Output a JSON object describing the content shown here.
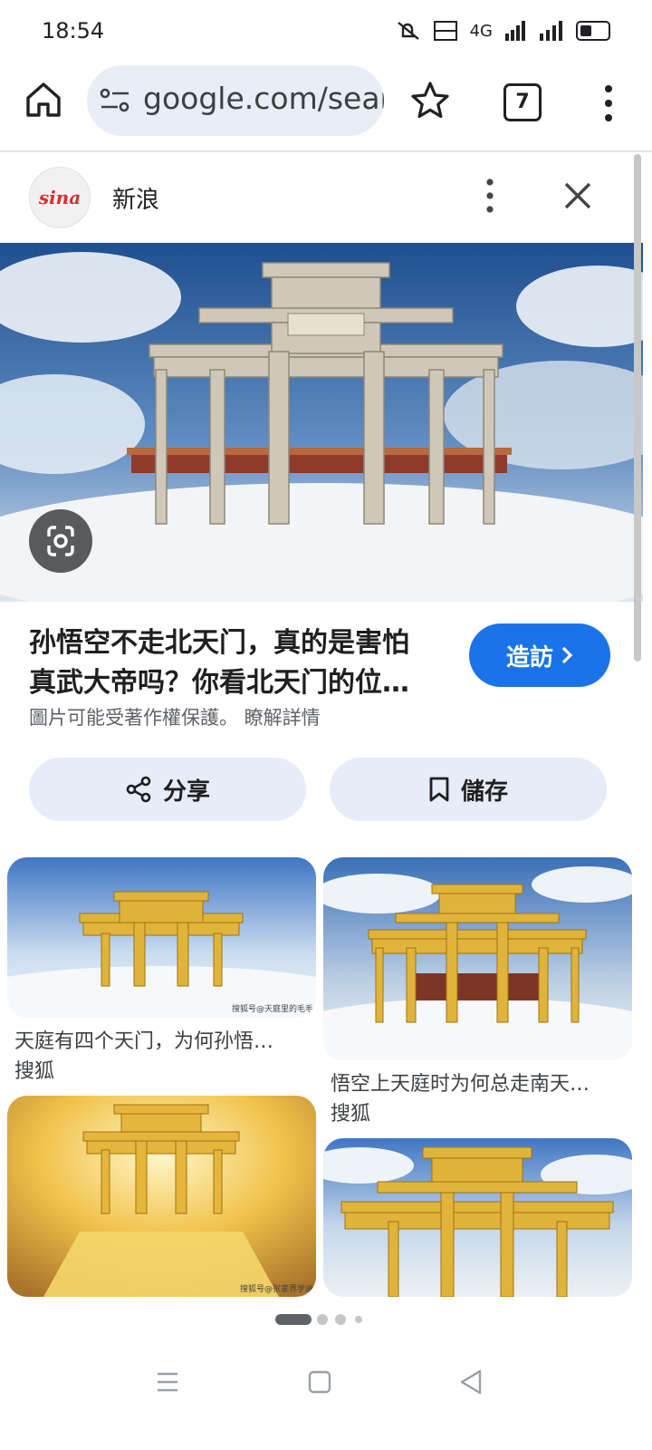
{
  "status_bar": {
    "time": "18:54",
    "indicators": [
      "mute-icon",
      "volte-icon",
      "signal-4g-icon",
      "signal-icon",
      "battery-icon"
    ],
    "network_label": "4G"
  },
  "browser": {
    "url": "google.com/search",
    "tab_count": "7"
  },
  "source": {
    "name": "新浪",
    "logo_text": "sina"
  },
  "result": {
    "title_line1": "孙悟空不走北天门，真的是害怕",
    "title_line2": "真武大帝吗？你看北天门的位…",
    "visit_label": "造訪",
    "copyright_note": "圖片可能受著作權保護。 瞭解詳情"
  },
  "actions": {
    "share_label": "分享",
    "save_label": "儲存"
  },
  "related": [
    {
      "caption": "天庭有四个天门，为何孙悟…",
      "source": "搜狐",
      "watermark": "搜狐号@天庭里的毛毛"
    },
    {
      "caption": "悟空上天庭时为何总走南天…",
      "source": "搜狐"
    },
    {
      "caption": "",
      "source": "",
      "watermark": "搜狐号@张家界学迪"
    },
    {
      "caption": "",
      "source": ""
    }
  ],
  "colors": {
    "accent": "#1a73e8",
    "pill_bg": "#e9edf5",
    "action_bg": "#e6ecf8",
    "sina_red": "#d32f2f"
  }
}
